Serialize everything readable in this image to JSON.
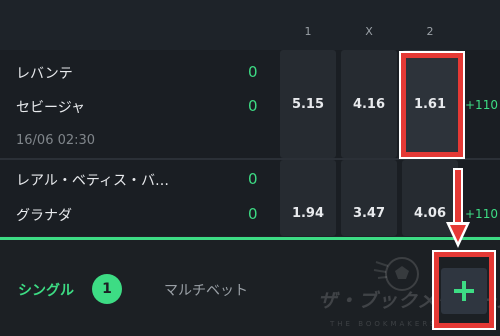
{
  "columns": {
    "home": "1",
    "draw": "X",
    "away": "2"
  },
  "matches": [
    {
      "home_team": "レバンテ",
      "away_team": "セビージャ",
      "home_score": "0",
      "away_score": "0",
      "time": "16/06 02:30",
      "odds": {
        "home": "5.15",
        "draw": "4.16",
        "away": "1.61"
      },
      "more_markets": "+110"
    },
    {
      "home_team": "レアル・ベティス・バ…",
      "away_team": "グラナダ",
      "home_score": "0",
      "away_score": "0",
      "odds": {
        "home": "1.94",
        "draw": "3.47",
        "away": "4.06"
      },
      "more_markets": "+110"
    }
  ],
  "betslip": {
    "single_tab": "シングル",
    "single_count": "1",
    "multi_tab": "マルチベット",
    "add_icon": "plus-icon"
  },
  "watermark": {
    "title": "ザ・ブックメーカーズ",
    "subtitle": "THE BOOKMAKERS"
  },
  "colors": {
    "accent": "#3ddc84",
    "highlight": "#e53935",
    "background": "#1e2329",
    "odds_cell": "#262b31"
  }
}
